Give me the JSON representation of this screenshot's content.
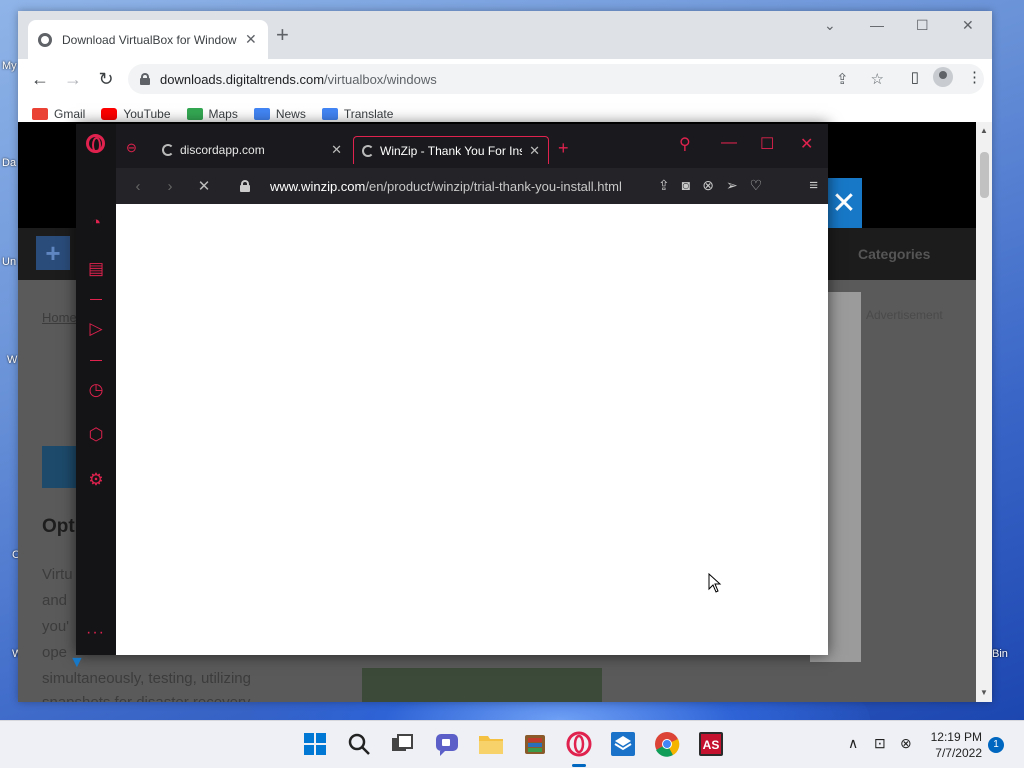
{
  "desktop": {
    "labels": [
      "My",
      "Da",
      "Un",
      "W",
      "C",
      "W",
      "Bin"
    ]
  },
  "chrome": {
    "tab_title": "Download VirtualBox for Windows",
    "new_tab": "+",
    "controls": {
      "dropdown": "⌄",
      "minimize": "—",
      "maximize": "☐",
      "close": "✕"
    },
    "url_host": "downloads.digitaltrends.com",
    "url_path": "/virtualbox/windows",
    "bookmarks": [
      {
        "label": "Gmail",
        "icon": "gmail-icon",
        "color": "#ea4335"
      },
      {
        "label": "YouTube",
        "icon": "youtube-icon",
        "color": "#ff0000"
      },
      {
        "label": "Maps",
        "icon": "maps-icon",
        "color": "#34a853"
      },
      {
        "label": "News",
        "icon": "news-icon",
        "color": "#4285f4"
      },
      {
        "label": "Translate",
        "icon": "translate-icon",
        "color": "#4285f4"
      }
    ]
  },
  "page": {
    "home_link": "Home",
    "categories": "Categories",
    "advertisement": "Advertisement",
    "ad_small": "ment",
    "heading": "Opt",
    "text_lines": [
      "Virtu",
      "and",
      "you'",
      "ope",
      "simultaneously, testing, utilizing",
      "snapshots for disaster recovery"
    ]
  },
  "opera": {
    "tabs": [
      {
        "title": "discordapp.com"
      },
      {
        "title": "WinZip - Thank You For Installing"
      }
    ],
    "new_tab": "+",
    "url_domain": "www.winzip.com",
    "url_path": "/en/product/winzip/trial-thank-you-install.html",
    "sidebar_more": "···"
  },
  "taskbar": {
    "time": "12:19 PM",
    "date": "7/7/2022",
    "notifications": "1",
    "apps": [
      {
        "name": "start",
        "color": "#0078d4"
      },
      {
        "name": "search",
        "color": "#222222"
      },
      {
        "name": "task-view",
        "color": "#222222"
      },
      {
        "name": "chat",
        "color": "#5b5fc7"
      },
      {
        "name": "file-explorer",
        "color": "#f4c142"
      },
      {
        "name": "winrar",
        "color": "#8a5a2b"
      },
      {
        "name": "opera-gx",
        "color": "#e0224e"
      },
      {
        "name": "virtualbox",
        "color": "#1a73c8"
      },
      {
        "name": "chrome",
        "color": "#4285f4"
      },
      {
        "name": "anysoftware",
        "color": "#c4122f"
      }
    ]
  }
}
